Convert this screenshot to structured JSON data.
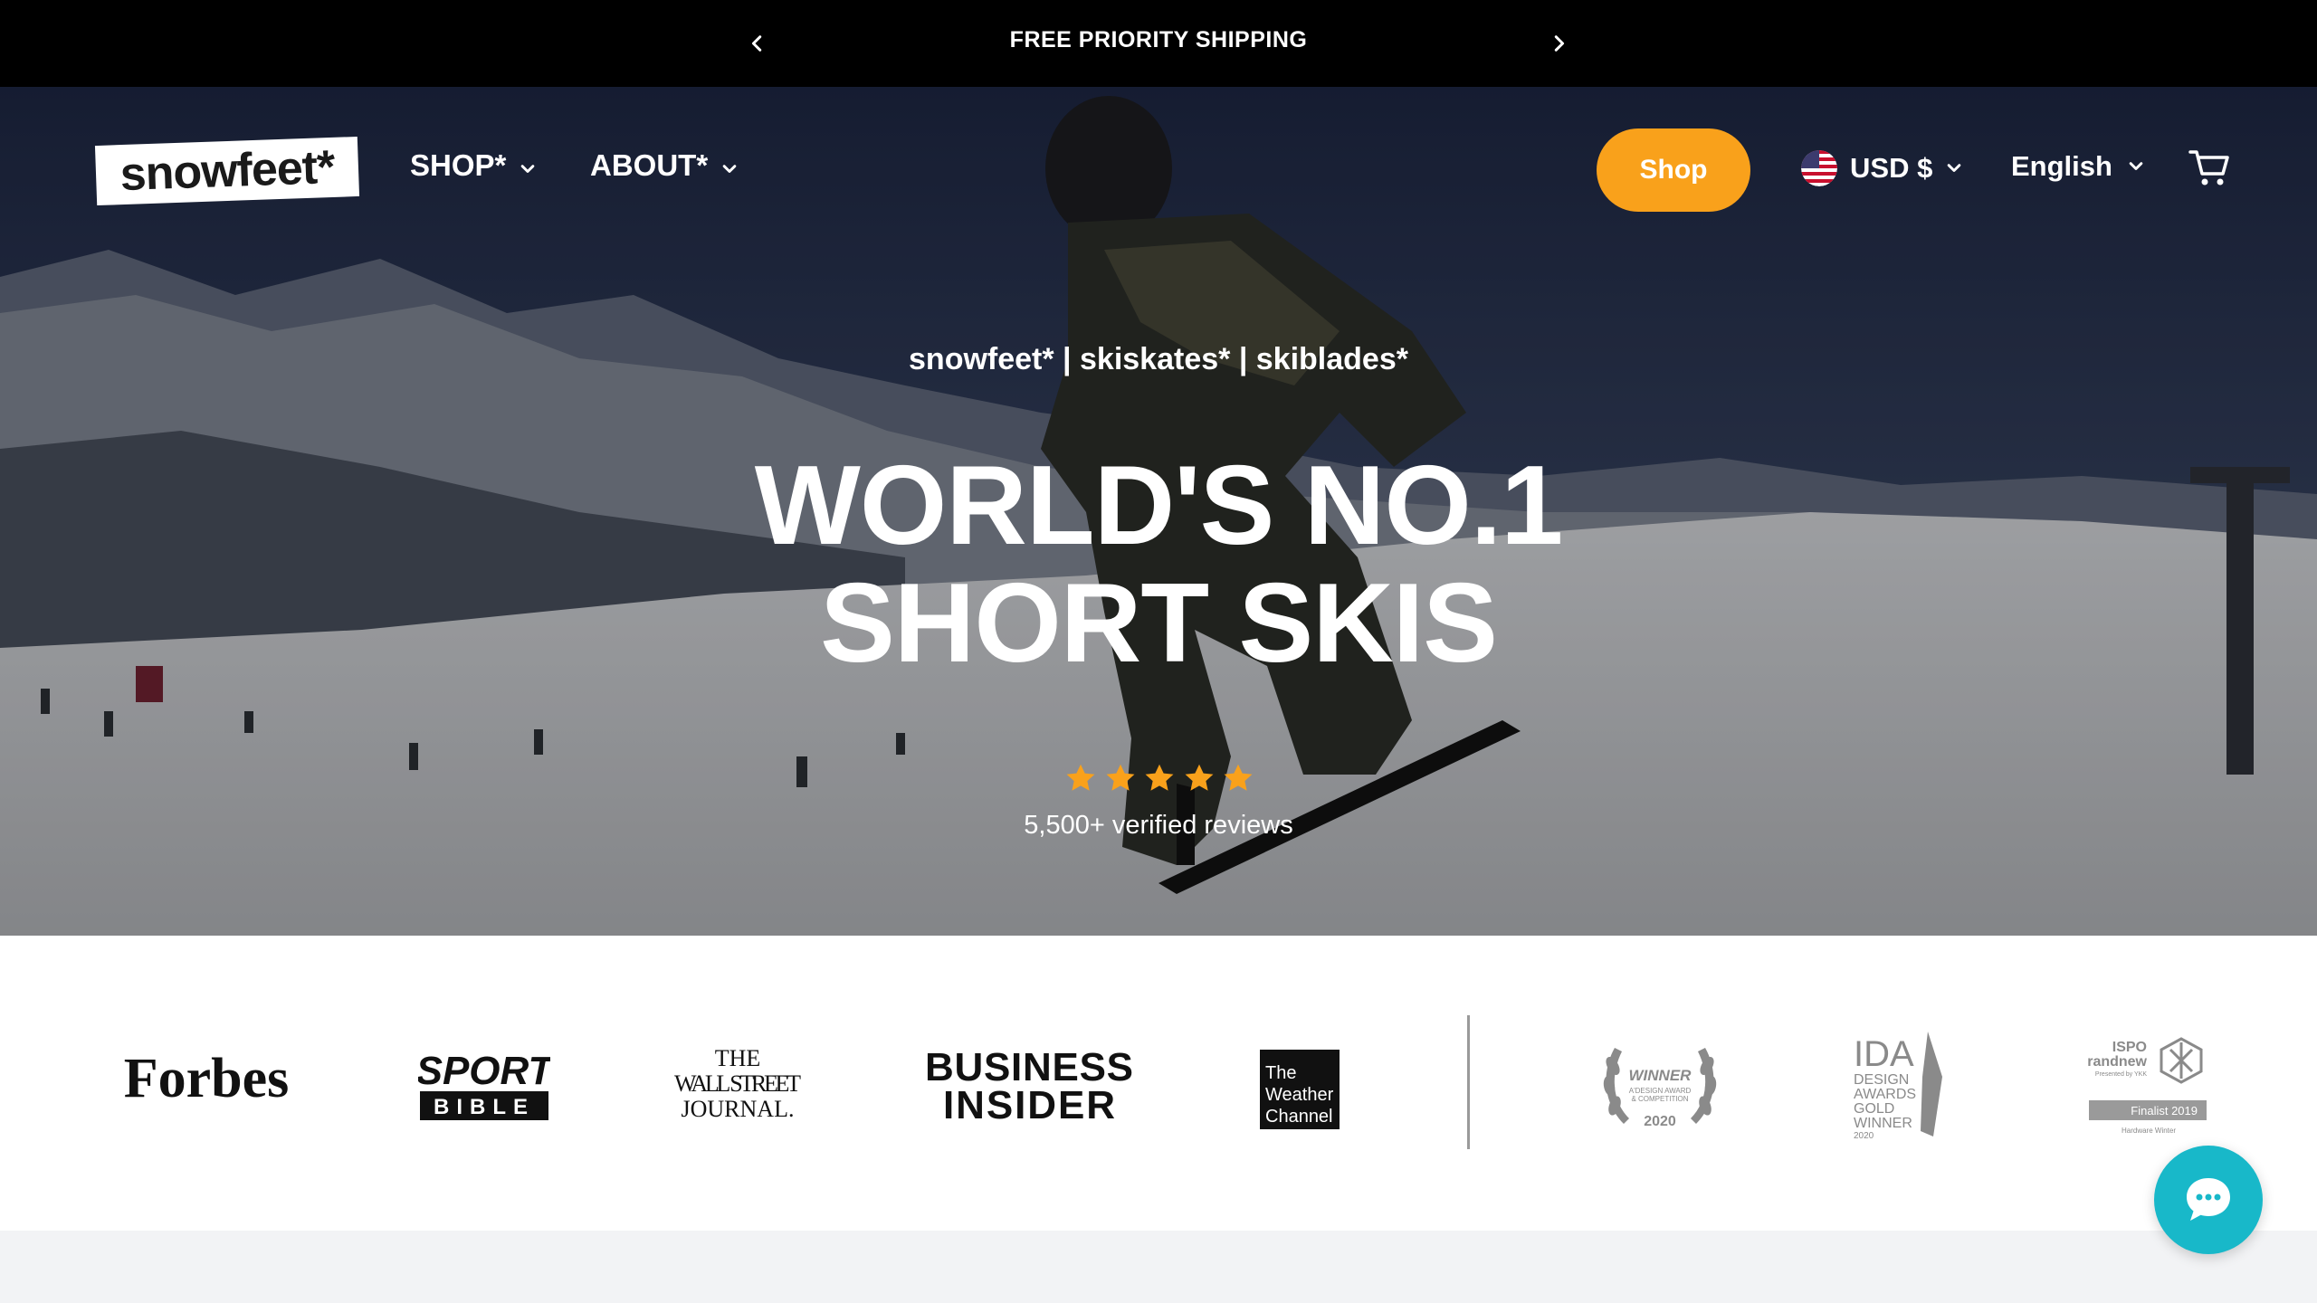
{
  "announcement": {
    "text": "FREE PRIORITY SHIPPING",
    "prev_icon": "chevron-left-icon",
    "next_icon": "chevron-right-icon"
  },
  "header": {
    "logo_text": "snowfeet*",
    "nav": [
      {
        "label": "SHOP*",
        "icon": "chevron-down-icon"
      },
      {
        "label": "ABOUT*",
        "icon": "chevron-down-icon"
      }
    ],
    "shop_button": "Shop",
    "currency": "USD $",
    "currency_flag": "us-flag-icon",
    "language": "English",
    "cart_icon": "cart-icon"
  },
  "hero": {
    "subtitle": "snowfeet* | skiskates* | skiblades*",
    "title_line1": "WORLD'S NO.1",
    "title_line2": "SHORT SKIS",
    "rating_stars": 5,
    "reviews": "5,500+ verified reviews"
  },
  "press": {
    "forbes": "Forbes",
    "sport_bible_top": "SPORT",
    "sport_bible_bottom": "BIBLE",
    "wsj_line1": "THE",
    "wsj_line2": "WALL STREET",
    "wsj_line3": "JOURNAL.",
    "bi_line1": "BUSINESS",
    "bi_line2": "INSIDER",
    "weather_line1": "The",
    "weather_line2": "Weather",
    "weather_line3": "Channel",
    "award1_line1": "WINNER",
    "award1_line2": "A'DESIGN AWARD",
    "award1_line3": "& COMPETITION",
    "award1_year": "2020",
    "ida_title": "IDA",
    "ida_line1": "DESIGN",
    "ida_line2": "AWARDS",
    "ida_line3": "GOLD",
    "ida_line4": "WINNER",
    "ida_year": "2020",
    "ispo_line1": "ISPO",
    "ispo_line2": "Brandnew",
    "ispo_line3": "Presented by YKK",
    "ispo_finalist": "Finalist 2019",
    "ispo_category": "Hardware Winter"
  },
  "colors": {
    "accent": "#f9a11b",
    "chat": "#18b8c9",
    "announce_bg": "#000000",
    "star": "#f9a11b"
  },
  "chat_icon": "chat-bubble-icon"
}
